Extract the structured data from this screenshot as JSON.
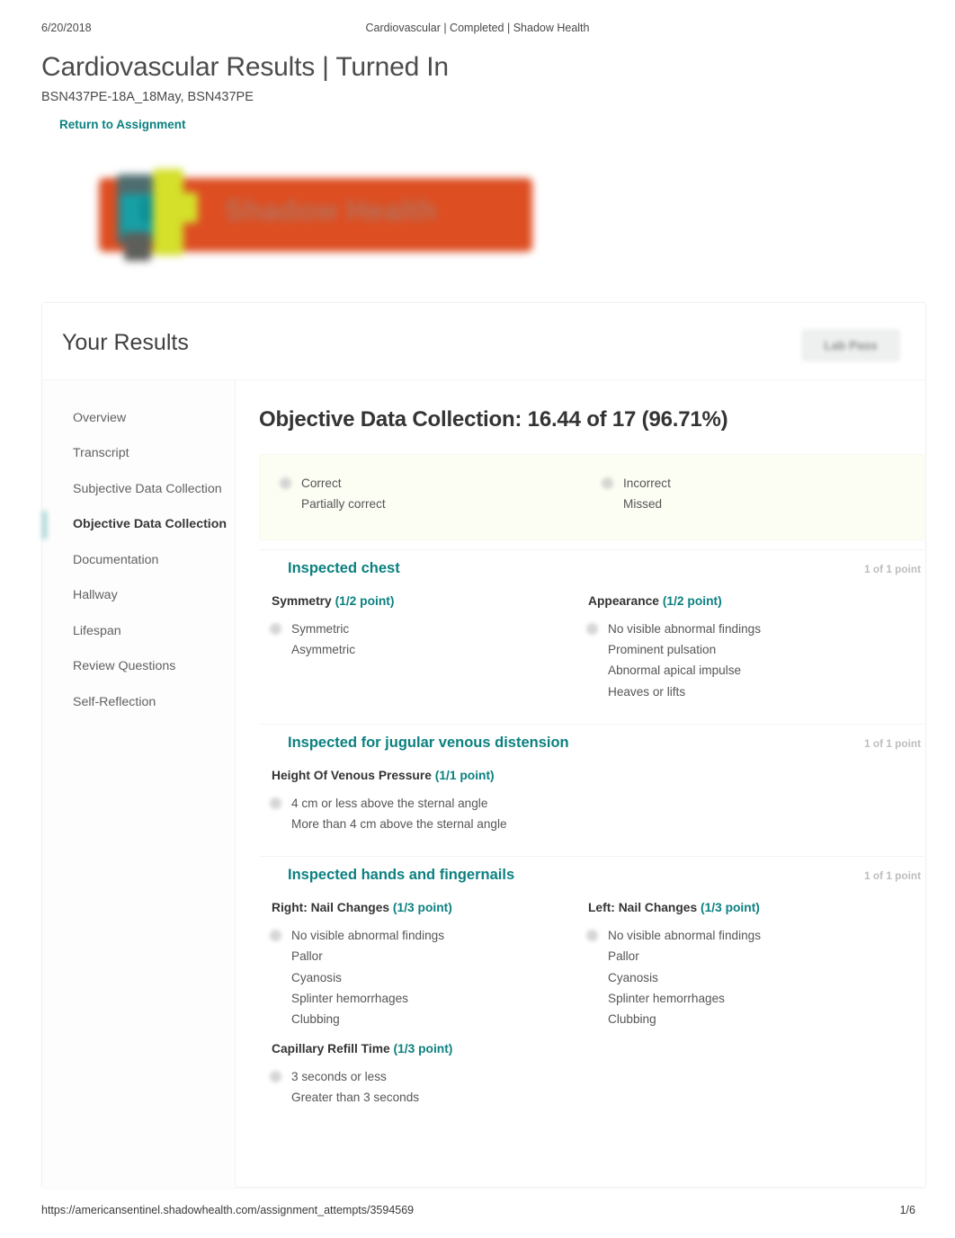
{
  "print_header": {
    "date": "6/20/2018",
    "title": "Cardiovascular | Completed | Shadow Health"
  },
  "page": {
    "title": "Cardiovascular Results | Turned In",
    "course": "BSN437PE-18A_18May, BSN437PE",
    "return_link": "Return to Assignment"
  },
  "logo": {
    "text": "Shadow Health",
    "bar_color": "#dd4e22",
    "accent_teal": "#16a0a5",
    "accent_lime": "#d4e02a"
  },
  "card": {
    "heading": "Your Results",
    "lab_pass_label": "Lab Pass"
  },
  "sidebar": {
    "items": [
      {
        "label": "Overview",
        "active": false
      },
      {
        "label": "Transcript",
        "active": false
      },
      {
        "label": "Subjective Data Collection",
        "active": false
      },
      {
        "label": "Objective Data Collection",
        "active": true
      },
      {
        "label": "Documentation",
        "active": false
      },
      {
        "label": "Hallway",
        "active": false
      },
      {
        "label": "Lifespan",
        "active": false
      },
      {
        "label": "Review Questions",
        "active": false
      },
      {
        "label": "Self-Reflection",
        "active": false
      }
    ]
  },
  "main": {
    "score_title": "Objective Data Collection: 16.44 of 17 (96.71%)",
    "score_earned": "16.44",
    "score_total": "17",
    "score_percent": "96.71%",
    "legend": {
      "left": [
        "Correct",
        "Partially correct"
      ],
      "right": [
        "Incorrect",
        "Missed"
      ]
    },
    "sections": [
      {
        "title": "Inspected chest",
        "points": "1 of 1 point",
        "groups": [
          {
            "label": "Symmetry",
            "points": "(1/2 point)",
            "options": [
              "Symmetric",
              "Asymmetric"
            ]
          },
          {
            "label": "Appearance",
            "points": "(1/2 point)",
            "options": [
              "No visible abnormal findings",
              "Prominent pulsation",
              "Abnormal apical impulse",
              "Heaves or lifts"
            ]
          }
        ]
      },
      {
        "title": "Inspected for jugular venous distension",
        "points": "1 of 1 point",
        "groups": [
          {
            "label": "Height Of Venous Pressure",
            "points": "(1/1 point)",
            "wide": true,
            "options": [
              "4 cm or less above the sternal angle",
              "More than 4 cm above the sternal angle"
            ]
          }
        ]
      },
      {
        "title": "Inspected hands and fingernails",
        "points": "1 of 1 point",
        "groups": [
          {
            "label": "Right: Nail Changes",
            "points": "(1/3 point)",
            "options": [
              "No visible abnormal findings",
              "Pallor",
              "Cyanosis",
              "Splinter hemorrhages",
              "Clubbing"
            ]
          },
          {
            "label": "Left: Nail Changes",
            "points": "(1/3 point)",
            "options": [
              "No visible abnormal findings",
              "Pallor",
              "Cyanosis",
              "Splinter hemorrhages",
              "Clubbing"
            ]
          }
        ],
        "groups2": [
          {
            "label": "Capillary Refill Time",
            "points": "(1/3 point)",
            "wide": true,
            "options": [
              "3 seconds or less",
              "Greater than 3 seconds"
            ]
          }
        ]
      }
    ]
  },
  "footer": {
    "url": "https://americansentinel.shadowhealth.com/assignment_attempts/3594569",
    "page_number": "1/6"
  },
  "colors": {
    "teal": "#0c8080",
    "orange": "#dd4e22",
    "text": "#565656",
    "heading": "#343434",
    "muted": "#bdbdbd"
  }
}
